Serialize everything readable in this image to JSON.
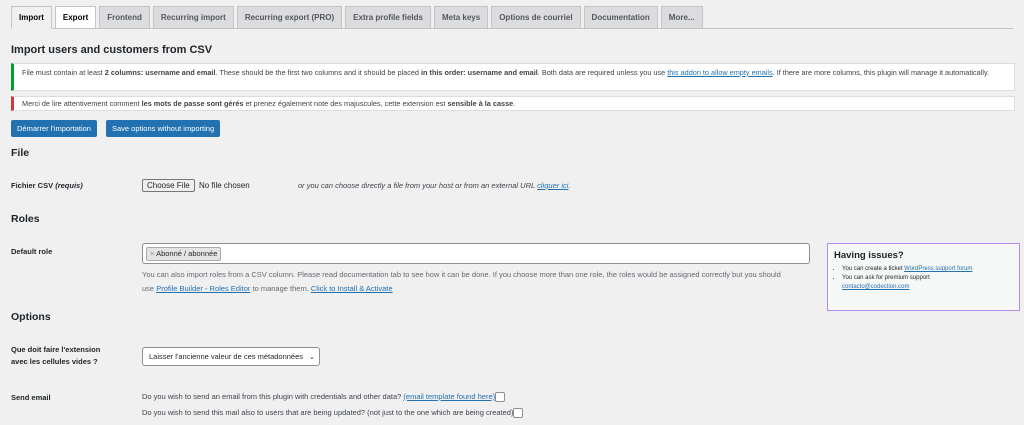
{
  "tabs": [
    "Import",
    "Export",
    "Frontend",
    "Recurring import",
    "Recurring export (PRO)",
    "Extra profile fields",
    "Meta keys",
    "Options de courriel",
    "Documentation",
    "More..."
  ],
  "title": "Import users and customers from CSV",
  "notice1": {
    "a": "File must contain at least ",
    "b": "2 columns: username and email",
    "c": ". These should be the first two columns and it should be placed ",
    "d": "in this order: username and email",
    "e": ". Both data are required unless you use ",
    "link": "this addon to allow empty emails",
    "f": ". If there are more columns, this plugin will manage it automatically."
  },
  "notice2": {
    "a": "Merci de lire attentivement comment ",
    "b": "les mots de passe sont gérés",
    "c": " et prenez également note des majuscules, cette extension est ",
    "d": "sensible à la casse",
    "e": "."
  },
  "buttons": {
    "start": "Démarrer l'importation",
    "save": "Save options without importing"
  },
  "file": {
    "heading": "File",
    "label": "Fichier CSV",
    "req": "(requis)",
    "choose": "Choose File",
    "none": "No file chosen",
    "alt": "or you can choose directly a file from your host or from an external URL ",
    "alt_link": "cliquer ici",
    "alt_end": "."
  },
  "roles": {
    "heading": "Roles",
    "label": "Default role",
    "chip": "Abonné / abonnée",
    "chip_x": "×",
    "desc": "You can also import roles from a CSV column. Please read documentation tab to see how it can be done. If you choose more than one role, the roles would be assigned correctly but you should use ",
    "link1": "Profile Builder - Roles Editor",
    "mid": " to manage them. ",
    "link2": "Click to Install & Activate"
  },
  "help": {
    "title": "Having issues?",
    "item1": "You can create a ticket ",
    "link1": "WordPress support forum",
    "item2": "You can ask for premium support ",
    "link2": "contacto@codection.com"
  },
  "options": {
    "heading": "Options",
    "empty_label": "Que doit faire l'extension avec les cellules vides ?",
    "empty_value": "Laisser l'ancienne valeur de ces métadonnées",
    "send_label": "Send email",
    "send1": "Do you wish to send an email from this plugin with credentials and other data? ",
    "send1_link": "(email template found here)",
    "send2": "Do you wish to send this mail also to users that are being updated? (not just to the one which are being created)"
  }
}
